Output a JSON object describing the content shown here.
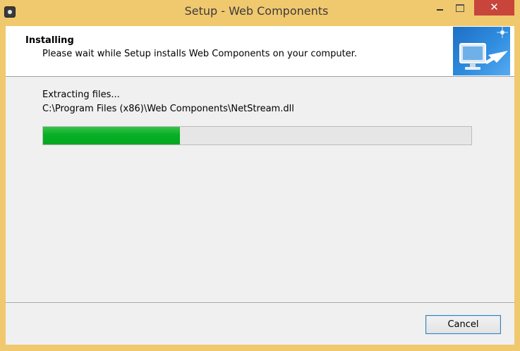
{
  "window": {
    "title": "Setup - Web Components",
    "close_glyph": "✕",
    "frame_color": "#f0c86e",
    "close_color": "#c7453a"
  },
  "header": {
    "title": "Installing",
    "subtitle": "Please wait while Setup installs Web Components on your computer.",
    "image_icon": "computer-monitor-arrow-icon"
  },
  "main": {
    "status": "Extracting files...",
    "current_file": "C:\\Program Files (x86)\\Web Components\\NetStream.dll",
    "progress": {
      "value": 0.32,
      "fill_color": "#06b025"
    }
  },
  "footer": {
    "cancel_label": "Cancel"
  }
}
